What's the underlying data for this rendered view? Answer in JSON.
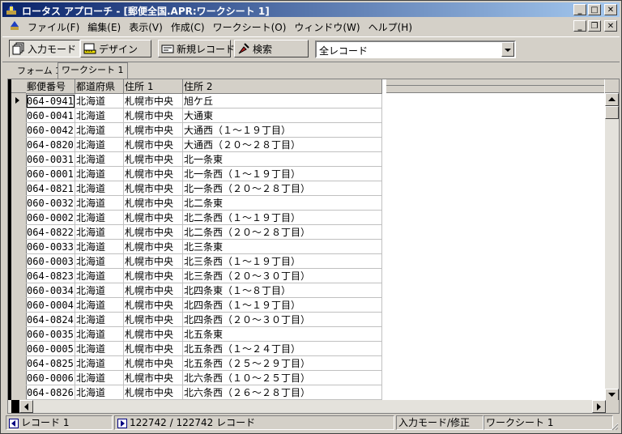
{
  "window": {
    "title": "ロータス アプローチ - [郵便全国.APR:ワークシート 1]"
  },
  "menu": [
    "ファイル(F)",
    "編集(E)",
    "表示(V)",
    "作成(C)",
    "ワークシート(O)",
    "ウィンドウ(W)",
    "ヘルプ(H)"
  ],
  "toolbar": {
    "input_mode": "入力モード",
    "design": "デザイン",
    "new_record": "新規レコード",
    "search": "検索",
    "filter_value": "全レコード"
  },
  "tabs": [
    "フォーム 1",
    "ワークシート 1"
  ],
  "grid": {
    "columns": [
      "郵便番号",
      "都道府県",
      "住所 1",
      "住所 2"
    ],
    "rows": [
      [
        "064-0941",
        "北海道",
        "札幌市中央",
        "旭ケ丘"
      ],
      [
        "060-0041",
        "北海道",
        "札幌市中央",
        "大通東"
      ],
      [
        "060-0042",
        "北海道",
        "札幌市中央",
        "大通西（１～１９丁目）"
      ],
      [
        "064-0820",
        "北海道",
        "札幌市中央",
        "大通西（２０～２８丁目）"
      ],
      [
        "060-0031",
        "北海道",
        "札幌市中央",
        "北一条東"
      ],
      [
        "060-0001",
        "北海道",
        "札幌市中央",
        "北一条西（１～１９丁目）"
      ],
      [
        "064-0821",
        "北海道",
        "札幌市中央",
        "北一条西（２０～２８丁目）"
      ],
      [
        "060-0032",
        "北海道",
        "札幌市中央",
        "北二条東"
      ],
      [
        "060-0002",
        "北海道",
        "札幌市中央",
        "北二条西（１～１９丁目）"
      ],
      [
        "064-0822",
        "北海道",
        "札幌市中央",
        "北二条西（２０～２８丁目）"
      ],
      [
        "060-0033",
        "北海道",
        "札幌市中央",
        "北三条東"
      ],
      [
        "060-0003",
        "北海道",
        "札幌市中央",
        "北三条西（１～１９丁目）"
      ],
      [
        "064-0823",
        "北海道",
        "札幌市中央",
        "北三条西（２０～３０丁目）"
      ],
      [
        "060-0034",
        "北海道",
        "札幌市中央",
        "北四条東（１～８丁目）"
      ],
      [
        "060-0004",
        "北海道",
        "札幌市中央",
        "北四条西（１～１９丁目）"
      ],
      [
        "064-0824",
        "北海道",
        "札幌市中央",
        "北四条西（２０～３０丁目）"
      ],
      [
        "060-0035",
        "北海道",
        "札幌市中央",
        "北五条東"
      ],
      [
        "060-0005",
        "北海道",
        "札幌市中央",
        "北五条西（１～２４丁目）"
      ],
      [
        "064-0825",
        "北海道",
        "札幌市中央",
        "北五条西（２５～２９丁目）"
      ],
      [
        "060-0006",
        "北海道",
        "札幌市中央",
        "北六条西（１０～２５丁目）"
      ],
      [
        "064-0826",
        "北海道",
        "札幌市中央",
        "北六条西（２６～２８丁目）"
      ]
    ]
  },
  "status": {
    "record": "レコード 1",
    "count": "122742 / 122742 レコード",
    "mode": "入力モード/修正",
    "view": "ワークシート 1"
  }
}
